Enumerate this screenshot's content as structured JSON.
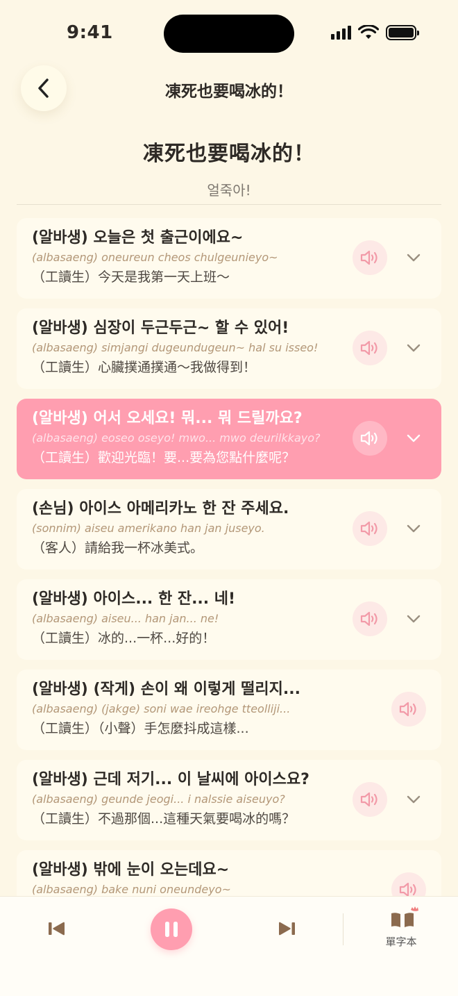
{
  "status_bar": {
    "time": "9:41"
  },
  "nav": {
    "title": "凍死也要喝冰的！"
  },
  "header": {
    "title": "凍死也要喝冰的！",
    "subtitle": "얼죽아!"
  },
  "colors": {
    "accent": "#ff9eb0",
    "background": "#fdf7e6",
    "icon_brown": "#8b6a4e",
    "romanization": "#b39778"
  },
  "lines": [
    {
      "korean": "(알바생) 오늘은 첫 출근이에요~",
      "romanization": "(albasaeng) oneureun cheos chulgeunieyo~",
      "chinese": "（工讀生）今天是我第一天上班～",
      "active": false,
      "expandable": true
    },
    {
      "korean": "(알바생) 심장이 두근두근~ 할 수 있어!",
      "romanization": "(albasaeng) simjangi dugeundugeun~ hal su isseo!",
      "chinese": "（工讀生）心臟撲通撲通～我做得到！",
      "active": false,
      "expandable": true
    },
    {
      "korean": "(알바생) 어서 오세요! 뭐... 뭐 드릴까요?",
      "romanization": "(albasaeng) eoseo oseyo! mwo... mwo deurilkkayo?",
      "chinese": "（工讀生）歡迎光臨！要...要為您點什麼呢？",
      "active": true,
      "expandable": true
    },
    {
      "korean": "(손님) 아이스 아메리카노 한 잔 주세요.",
      "romanization": "(sonnim) aiseu amerikano han jan juseyo.",
      "chinese": "（客人）請給我一杯冰美式。",
      "active": false,
      "expandable": true
    },
    {
      "korean": "(알바생) 아이스... 한 잔... 네!",
      "romanization": "(albasaeng) aiseu... han jan... ne!",
      "chinese": "（工讀生）冰的...一杯...好的！",
      "active": false,
      "expandable": true
    },
    {
      "korean": "(알바생) (작게) 손이 왜 이렇게 떨리지...",
      "romanization": "(albasaeng) (jakge) soni wae ireohge tteolliji...",
      "chinese": "（工讀生）（小聲）手怎麼抖成這樣...",
      "active": false,
      "expandable": false
    },
    {
      "korean": "(알바생) 근데 저기... 이 날씨에 아이스요?",
      "romanization": "(albasaeng) geunde jeogi... i nalssie aiseuyo?",
      "chinese": "（工讀生）不過那個...這種天氣要喝冰的嗎？",
      "active": false,
      "expandable": true
    },
    {
      "korean": "(알바생) 밖에 눈이 오는데요~",
      "romanization": "(albasaeng) bake nuni oneundeyo~",
      "chinese": "",
      "active": false,
      "expandable": false
    }
  ],
  "player": {
    "state": "playing",
    "vocab_label": "單字本"
  }
}
